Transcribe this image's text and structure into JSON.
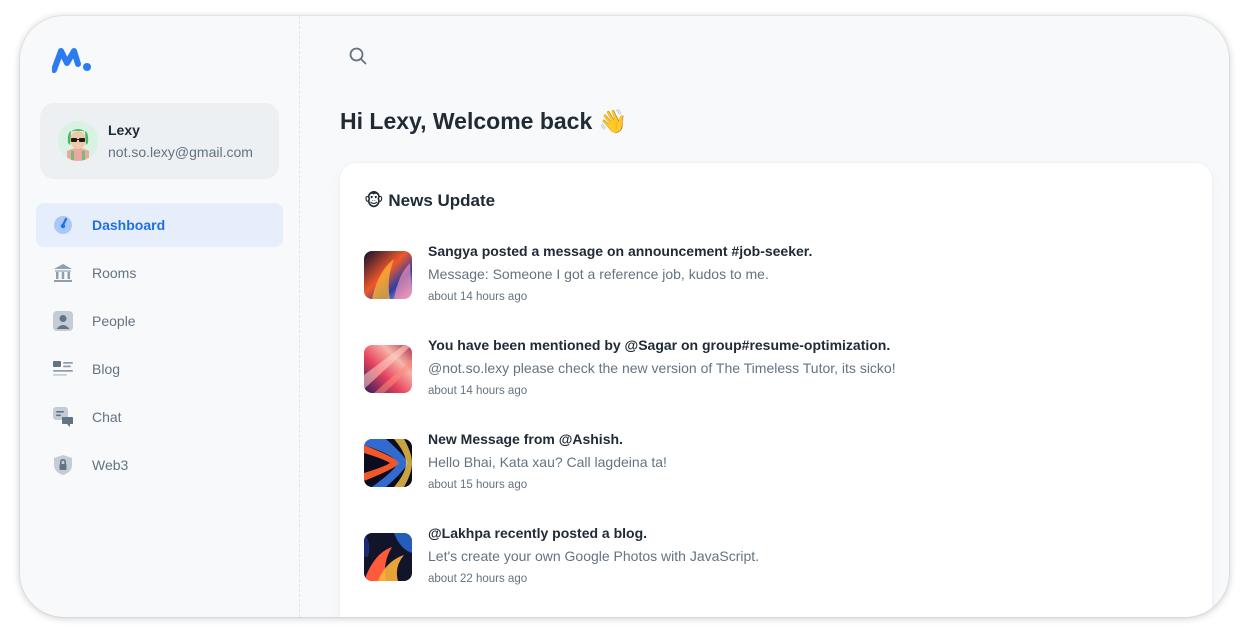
{
  "app": {
    "logo_icon": "brand-logo-icon",
    "accent_color": "#1f6fe5"
  },
  "account": {
    "name": "Lexy",
    "email": "not.so.lexy@gmail.com"
  },
  "nav": [
    {
      "label": "Dashboard",
      "icon": "dashboard-icon",
      "active": true
    },
    {
      "label": "Rooms",
      "icon": "bank-icon",
      "active": false
    },
    {
      "label": "People",
      "icon": "user-icon",
      "active": false
    },
    {
      "label": "Blog",
      "icon": "blog-icon",
      "active": false
    },
    {
      "label": "Chat",
      "icon": "chat-icon",
      "active": false
    },
    {
      "label": "Web3",
      "icon": "shield-lock-icon",
      "active": false
    }
  ],
  "header": {
    "search_icon": "search-icon"
  },
  "greeting": "Hi Lexy, Welcome back 👋",
  "news": {
    "title": "🐵 News Update",
    "items": [
      {
        "title": "Sangya posted a message on announcement #job-seeker.",
        "message": "Message: Someone I got a reference job, kudos to me.",
        "time": "about 14 hours ago"
      },
      {
        "title": "You have been mentioned by @Sagar on group#resume-optimization.",
        "message": "@not.so.lexy please check the new version of The Timeless Tutor, its sicko!",
        "time": "about 14 hours ago"
      },
      {
        "title": "New Message from @Ashish.",
        "message": "Hello Bhai, Kata xau? Call lagdeina ta!",
        "time": "about 15 hours ago"
      },
      {
        "title": "@Lakhpa recently posted a blog.",
        "message": "Let's create your own Google Photos with JavaScript.",
        "time": "about 22 hours ago"
      }
    ]
  }
}
